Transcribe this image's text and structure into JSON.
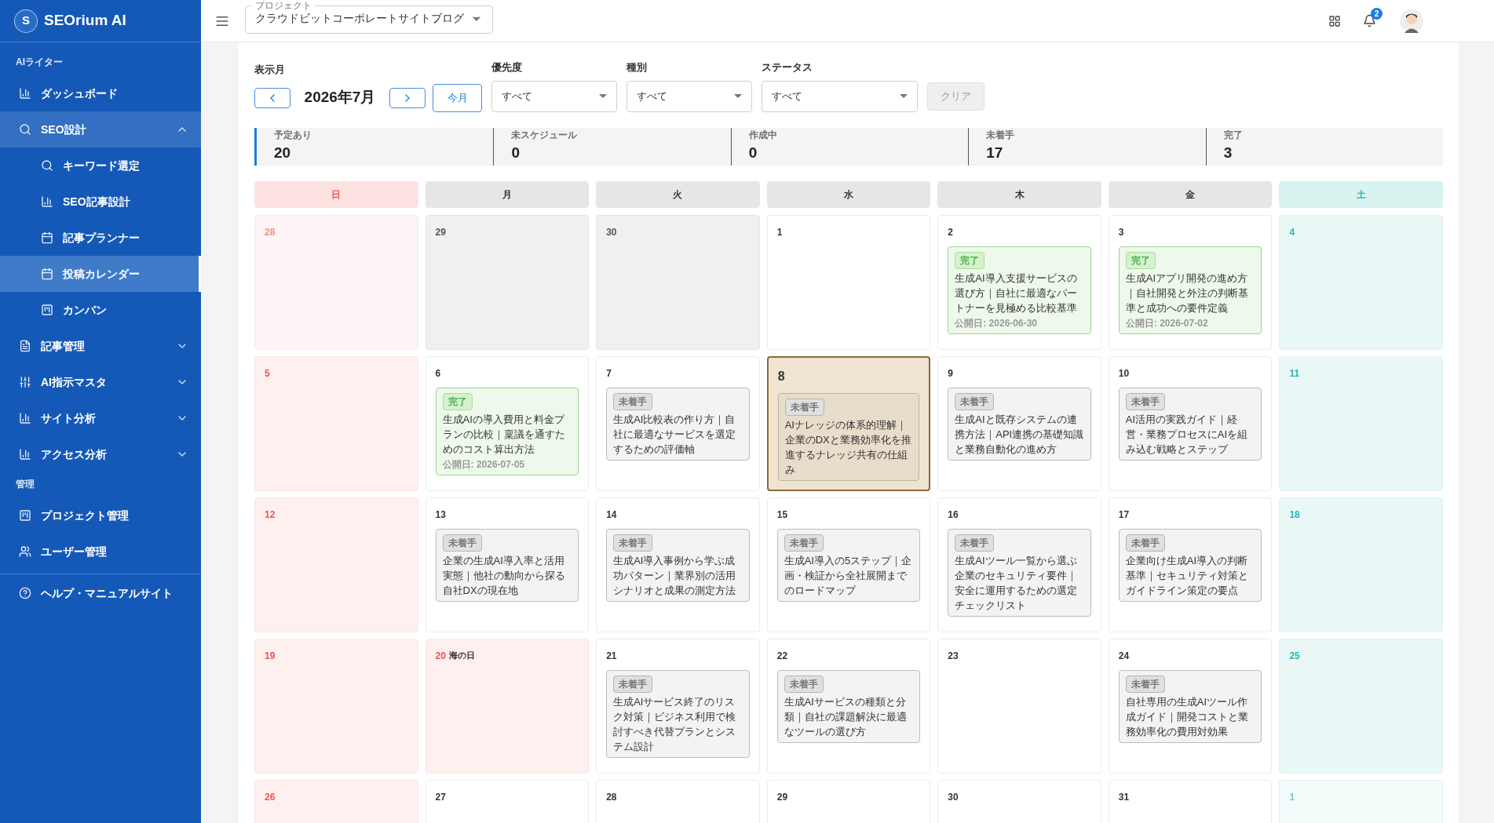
{
  "brand": {
    "letter": "S",
    "name": "SEOrium AI"
  },
  "sidebar": {
    "sections": [
      {
        "heading": "AIライター",
        "items": [
          {
            "label": "ダッシュボード",
            "selected": false
          },
          {
            "label": "SEO設計",
            "selected": false,
            "expanded": true,
            "children": [
              {
                "label": "キーワード選定",
                "selected": false
              },
              {
                "label": "SEO記事設計",
                "selected": false
              },
              {
                "label": "記事プランナー",
                "selected": false
              },
              {
                "label": "投稿カレンダー",
                "selected": true
              },
              {
                "label": "カンバン",
                "selected": false
              }
            ]
          },
          {
            "label": "記事管理",
            "selected": false,
            "expanded": false
          },
          {
            "label": "AI指示マスタ",
            "selected": false,
            "expanded": false
          },
          {
            "label": "サイト分析",
            "selected": false,
            "expanded": false
          },
          {
            "label": "アクセス分析",
            "selected": false,
            "expanded": false
          }
        ]
      },
      {
        "heading": "管理",
        "items": [
          {
            "label": "プロジェクト管理",
            "selected": false
          },
          {
            "label": "ユーザー管理",
            "selected": false
          }
        ]
      }
    ],
    "footer": {
      "label": "ヘルプ・マニュアルサイト",
      "selected": false
    }
  },
  "header": {
    "project": {
      "label": "プロジェクト",
      "value": "クラウドビットコーポレートサイトブログ"
    },
    "notifications": "2"
  },
  "filters": {
    "month_label": "表示月",
    "month": "2026年7月",
    "today_button": "今月",
    "selects": [
      {
        "label": "優先度",
        "value": "すべて"
      },
      {
        "label": "種別",
        "value": "すべて"
      },
      {
        "label": "ステータス",
        "value": "すべて"
      }
    ],
    "clear": {
      "label": "クリア",
      "disabled": true
    }
  },
  "stats": [
    {
      "label": "予定あり",
      "value": "20"
    },
    {
      "label": "未スケジュール",
      "value": "0"
    },
    {
      "label": "作成中",
      "value": "0"
    },
    {
      "label": "未着手",
      "value": "17"
    },
    {
      "label": "完了",
      "value": "3"
    }
  ],
  "weekdays": [
    "日",
    "月",
    "火",
    "水",
    "木",
    "金",
    "土"
  ],
  "weeks": [
    [
      {
        "day": "28",
        "in_month": false
      },
      {
        "day": "29",
        "in_month": false
      },
      {
        "day": "30",
        "in_month": false
      },
      {
        "day": "1",
        "in_month": true
      },
      {
        "day": "2",
        "in_month": true,
        "posts": [
          {
            "status": "完了",
            "kind": "done",
            "title": "生成AI導入支援サービスの選び方｜自社に最適なパートナーを見極める比較基準",
            "date": "公開日: 2026-06-30"
          }
        ]
      },
      {
        "day": "3",
        "in_month": true,
        "posts": [
          {
            "status": "完了",
            "kind": "done",
            "title": "生成AIアプリ開発の進め方｜自社開発と外注の判断基準と成功への要件定義",
            "date": "公開日: 2026-07-02"
          }
        ]
      },
      {
        "day": "4",
        "in_month": true
      }
    ],
    [
      {
        "day": "5",
        "in_month": true
      },
      {
        "day": "6",
        "in_month": true,
        "posts": [
          {
            "status": "完了",
            "kind": "done",
            "title": "生成AIの導入費用と料金プランの比較｜稟議を通すためのコスト算出方法",
            "date": "公開日: 2026-07-05"
          }
        ]
      },
      {
        "day": "7",
        "in_month": true,
        "posts": [
          {
            "status": "未着手",
            "kind": "todo",
            "title": "生成AI比較表の作り方｜自社に最適なサービスを選定するための評価軸"
          }
        ]
      },
      {
        "day": "8",
        "in_month": true,
        "today": true,
        "posts": [
          {
            "status": "未着手",
            "kind": "todo",
            "title": "AIナレッジの体系的理解｜企業のDXと業務効率化を推進するナレッジ共有の仕組み"
          }
        ]
      },
      {
        "day": "9",
        "in_month": true,
        "posts": [
          {
            "status": "未着手",
            "kind": "todo",
            "title": "生成AIと既存システムの連携方法｜API連携の基礎知識と業務自動化の進め方"
          }
        ]
      },
      {
        "day": "10",
        "in_month": true,
        "posts": [
          {
            "status": "未着手",
            "kind": "todo",
            "title": "AI活用の実践ガイド｜経営・業務プロセスにAIを組み込む戦略とステップ"
          }
        ]
      },
      {
        "day": "11",
        "in_month": true
      }
    ],
    [
      {
        "day": "12",
        "in_month": true
      },
      {
        "day": "13",
        "in_month": true,
        "posts": [
          {
            "status": "未着手",
            "kind": "todo",
            "title": "企業の生成AI導入率と活用実態｜他社の動向から探る自社DXの現在地"
          }
        ]
      },
      {
        "day": "14",
        "in_month": true,
        "posts": [
          {
            "status": "未着手",
            "kind": "todo",
            "title": "生成AI導入事例から学ぶ成功パターン｜業界別の活用シナリオと成果の測定方法"
          }
        ]
      },
      {
        "day": "15",
        "in_month": true,
        "posts": [
          {
            "status": "未着手",
            "kind": "todo",
            "title": "生成AI導入の5ステップ｜企画・検証から全社展開までのロードマップ"
          }
        ]
      },
      {
        "day": "16",
        "in_month": true,
        "posts": [
          {
            "status": "未着手",
            "kind": "todo",
            "title": "生成AIツール一覧から選ぶ企業のセキュリティ要件｜安全に運用するための選定チェックリスト"
          }
        ]
      },
      {
        "day": "17",
        "in_month": true,
        "posts": [
          {
            "status": "未着手",
            "kind": "todo",
            "title": "企業向け生成AI導入の判断基準｜セキュリティ対策とガイドライン策定の要点"
          }
        ]
      },
      {
        "day": "18",
        "in_month": true
      }
    ],
    [
      {
        "day": "19",
        "in_month": true
      },
      {
        "day": "20",
        "in_month": true,
        "holiday": "海の日"
      },
      {
        "day": "21",
        "in_month": true,
        "posts": [
          {
            "status": "未着手",
            "kind": "todo",
            "title": "生成AIサービス終了のリスク対策｜ビジネス利用で検討すべき代替プランとシステム設計"
          }
        ]
      },
      {
        "day": "22",
        "in_month": true,
        "posts": [
          {
            "status": "未着手",
            "kind": "todo",
            "title": "生成AIサービスの種類と分類｜自社の課題解決に最適なツールの選び方"
          }
        ]
      },
      {
        "day": "23",
        "in_month": true
      },
      {
        "day": "24",
        "in_month": true,
        "posts": [
          {
            "status": "未着手",
            "kind": "todo",
            "title": "自社専用の生成AIツール作成ガイド｜開発コストと業務効率化の費用対効果"
          }
        ]
      },
      {
        "day": "25",
        "in_month": true
      }
    ],
    [
      {
        "day": "26",
        "in_month": true
      },
      {
        "day": "27",
        "in_month": true
      },
      {
        "day": "28",
        "in_month": true
      },
      {
        "day": "29",
        "in_month": true
      },
      {
        "day": "30",
        "in_month": true
      },
      {
        "day": "31",
        "in_month": true
      },
      {
        "day": "1",
        "in_month": false
      }
    ]
  ]
}
